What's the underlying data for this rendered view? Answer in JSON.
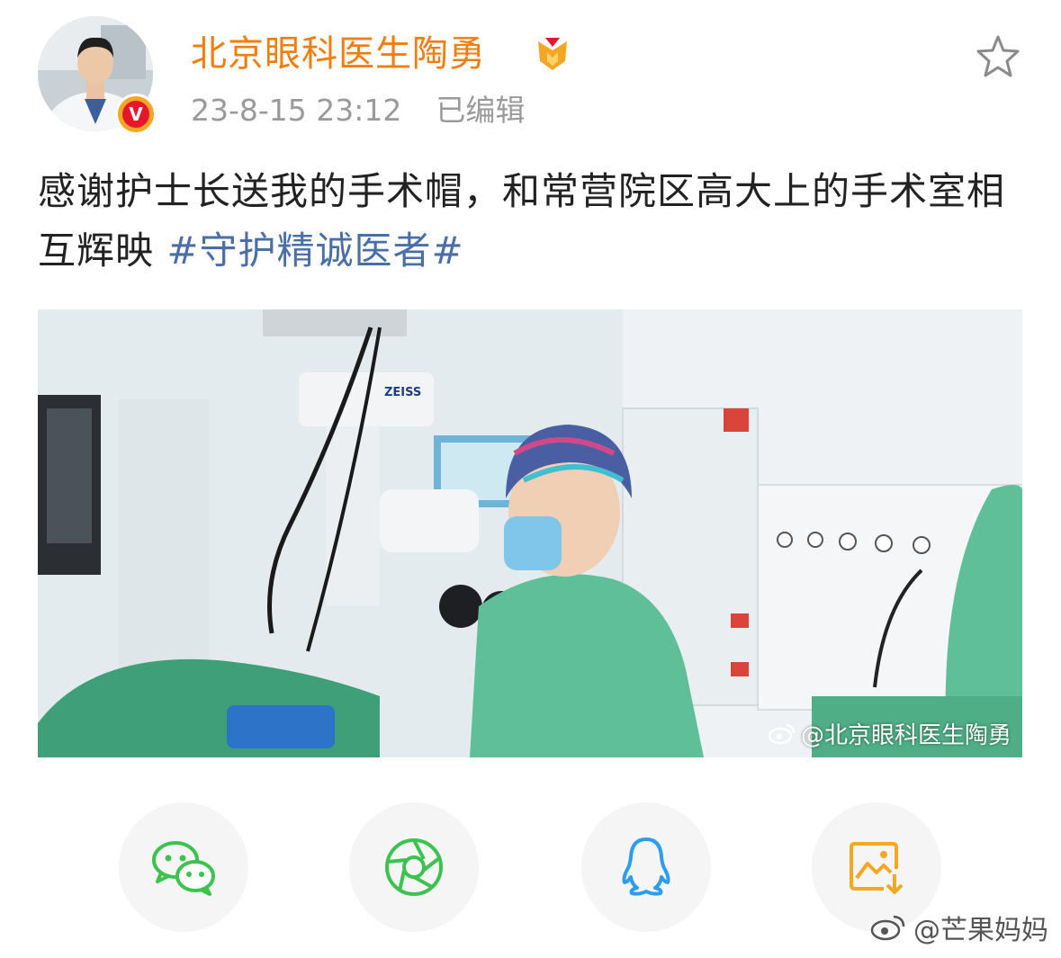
{
  "post": {
    "author": "北京眼科医生陶勇",
    "timestamp": "23-8-15 23:12",
    "edited_label": "已编辑",
    "text": "感谢护士长送我的手术帽，和常营院区高大上的手术室相互辉映 ",
    "hashtag": "#守护精诚医者#",
    "photo_watermark": "@北京眼科医生陶勇",
    "photo_device_brand": "ZEISS"
  },
  "share": [
    {
      "name": "wechat-icon",
      "color": "#3cc24f"
    },
    {
      "name": "moments-icon",
      "color": "#3cc24f"
    },
    {
      "name": "qq-icon",
      "color": "#2c9cf0"
    },
    {
      "name": "save-image-icon",
      "color": "#f5a623"
    }
  ],
  "page_watermark": "@芒果妈妈",
  "colors": {
    "author": "#f07d0c",
    "meta": "#9a9a9a",
    "hashtag": "#4a6ea8",
    "verified_badge": "#e6162d",
    "verified_ring": "#f5a623"
  }
}
